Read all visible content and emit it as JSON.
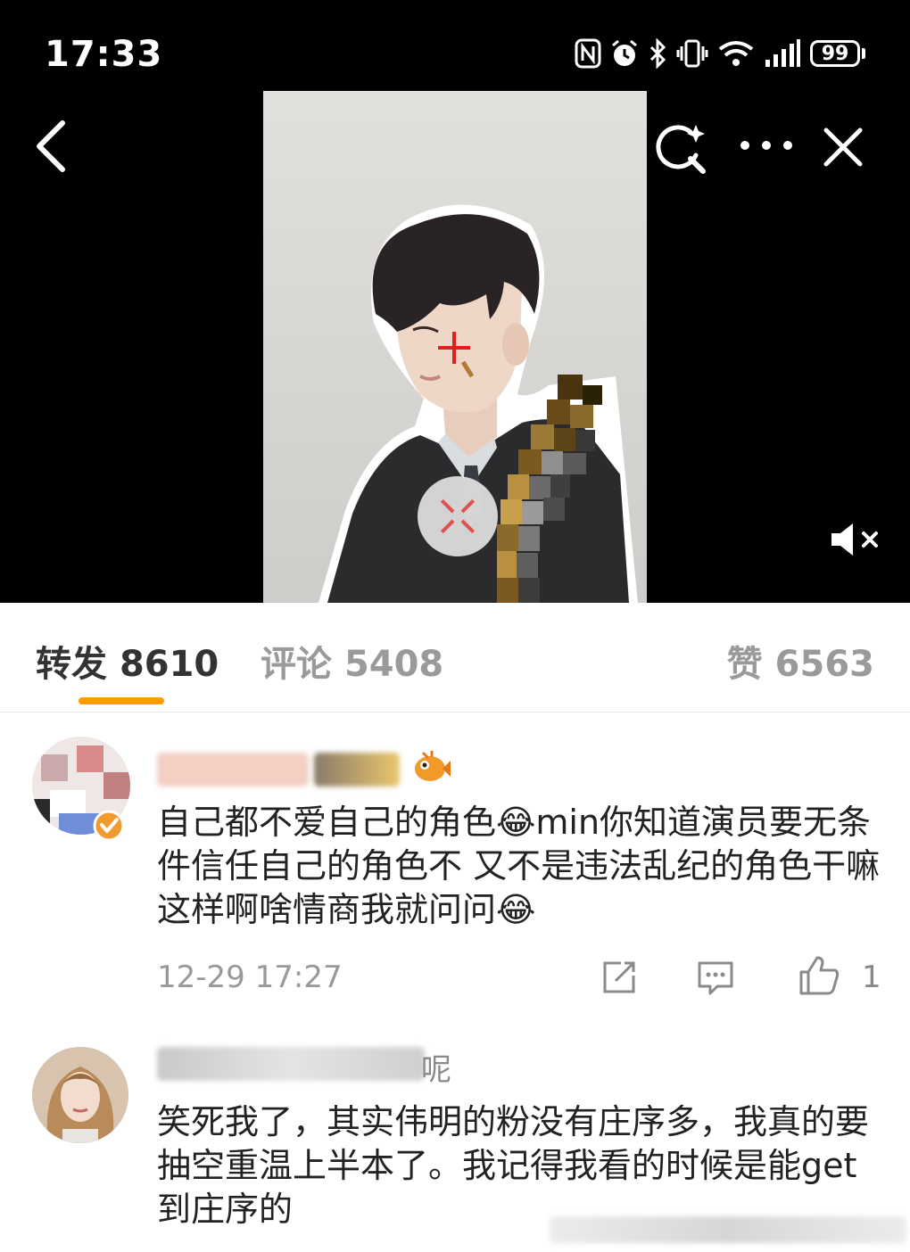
{
  "status_bar": {
    "time": "17:33",
    "battery": "99",
    "icons": [
      "nfc-icon",
      "alarm-icon",
      "bluetooth-icon",
      "vibrate-icon",
      "wifi-icon",
      "signal-icon",
      "battery-icon"
    ]
  },
  "viewer": {
    "toolbar_icons": [
      "back-icon",
      "visual-search-icon",
      "more-icon",
      "close-icon",
      "mute-icon",
      "play-icon"
    ]
  },
  "tabs": [
    {
      "label": "转发",
      "count": "8610"
    },
    {
      "label": "评论",
      "count": "5408"
    },
    {
      "label": "赞",
      "count": "6563"
    }
  ],
  "colors": {
    "accent": "#ff9a00",
    "active_tab": "#333333",
    "inactive_tab": "#9a9a9a"
  },
  "comments": [
    {
      "text": "自己都不爱自己的角色😂min你知道演员要无条件信任自己的角色不 又不是违法乱纪的角色干嘛这样啊啥情商我就问问😂",
      "time": "12-29 17:27",
      "likes": "1"
    },
    {
      "username_tail": "呢",
      "text": "笑死我了，其实伟明的粉没有庄序多，我真的要抽空重温上半本了。我记得我看的时候是能get到庄序的"
    }
  ]
}
